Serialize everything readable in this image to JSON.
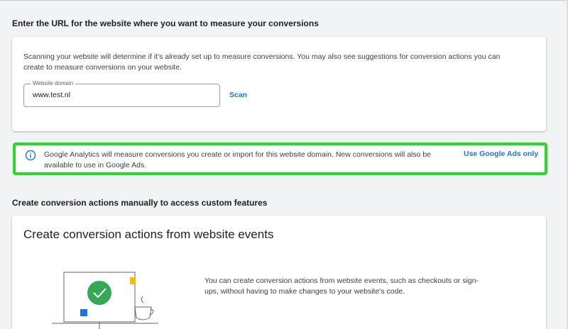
{
  "url_section": {
    "heading": "Enter the URL for the website where you want to measure your conversions",
    "description": "Scanning your website will determine if it's already set up to measure conversions. You may also see suggestions for conversion actions you can create to measure conversions on your website.",
    "field_label": "Website domain",
    "field_value": "www.test.nl",
    "scan_label": "Scan"
  },
  "ga_notice": {
    "text": "Google Analytics will measure conversions you create or import for this website domain. New conversions will also be available to use in Google Ads.",
    "link_label": "Use Google Ads only",
    "highlight_color": "#22dd22"
  },
  "manual_section": {
    "heading": "Create conversion actions manually to access custom features",
    "card_title": "Create conversion actions from website events",
    "card_description": "You can create conversion actions from website events, such as checkouts or sign-ups, without having to make changes to your website's code."
  },
  "colors": {
    "accent": "#1a73e8",
    "background": "#f1f3f4",
    "check_green": "#34a853",
    "note_yellow": "#fbbc04"
  }
}
